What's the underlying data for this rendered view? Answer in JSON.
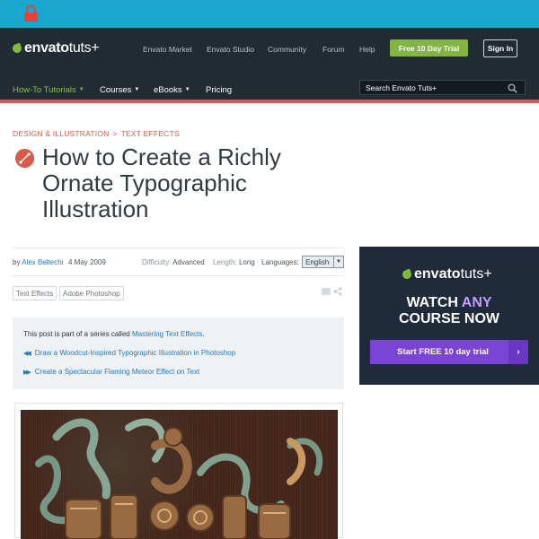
{
  "top_bar": {
    "lock_icon": "padlock-icon",
    "accent_color": "#1aa7ce"
  },
  "header": {
    "logo": {
      "envato": "envato",
      "tuts": "tuts+"
    },
    "links": [
      "Envato Market",
      "Envato Studio",
      "Community",
      "Forum",
      "Help"
    ],
    "trial_button": "Free 10 Day Trial",
    "signin_button": "Sign In",
    "nav": [
      {
        "label": "How-To Tutorials",
        "has_caret": true,
        "active": true
      },
      {
        "label": "Courses",
        "has_caret": true,
        "active": false
      },
      {
        "label": "eBooks",
        "has_caret": true,
        "active": false
      },
      {
        "label": "Pricing",
        "has_caret": false,
        "active": false
      }
    ],
    "search_placeholder": "Search Envato Tuts+",
    "search_icon": "search-icon"
  },
  "article": {
    "breadcrumb": {
      "category": "DESIGN & ILLUSTRATION",
      "separator": ">",
      "subcategory": "TEXT EFFECTS"
    },
    "category_icon": "pen-tool-icon",
    "title": "How to Create a Richly Ornate Typographic Illustration",
    "meta": {
      "by_label": "by",
      "author": "Alex Beltechi",
      "date": "4 May 2009",
      "difficulty_label": "Difficulty:",
      "difficulty": "Advanced",
      "length_label": "Length:",
      "length": "Long",
      "languages_label": "Languages:",
      "language_selected": "English"
    },
    "tags": [
      "Text Effects",
      "Adobe Photoshop"
    ],
    "series": {
      "intro_prefix": "This post is part of a series called",
      "series_name": "Mastering Text Effects",
      "intro_suffix": ".",
      "prev": "Draw a Woodcut-Inspired Typographic Illustration in Photoshop",
      "next": "Create a Spectacular Flaming Meteor Effect on Text"
    }
  },
  "ad": {
    "logo": {
      "envato": "envato",
      "tuts": "tuts+"
    },
    "headline_1a": "WATCH ",
    "headline_1b": "ANY",
    "headline_2": "COURSE NOW",
    "button": "Start FREE 10 day trial",
    "button_arrow": "›"
  }
}
